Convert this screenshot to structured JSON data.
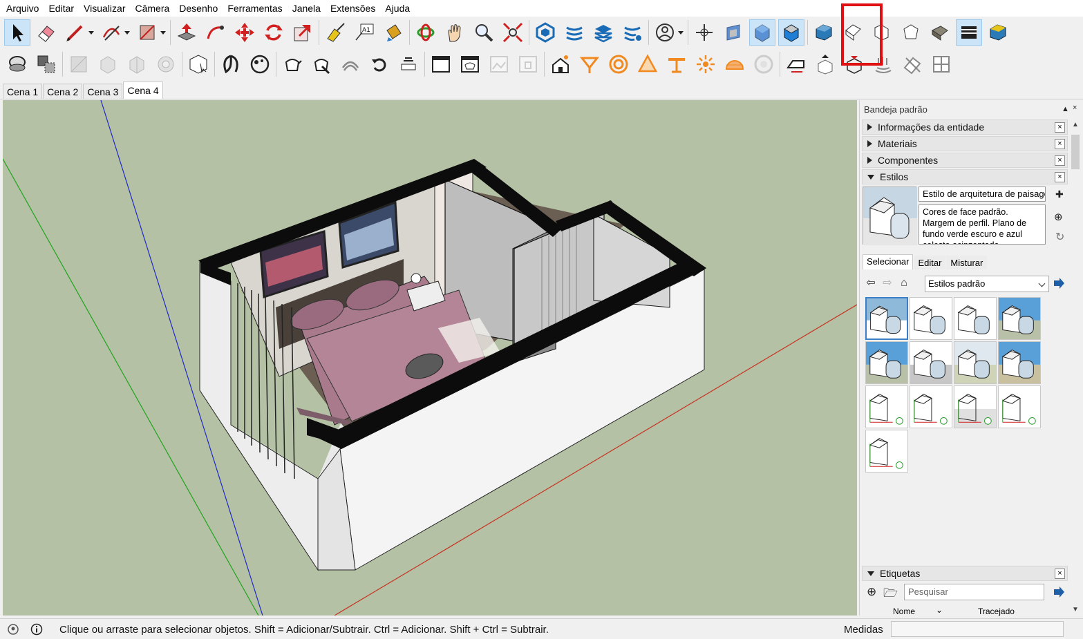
{
  "menu": [
    "Arquivo",
    "Editar",
    "Visualizar",
    "Câmera",
    "Desenho",
    "Ferramentas",
    "Janela",
    "Extensões",
    "Ajuda"
  ],
  "toolbar1": [
    {
      "name": "select-icon",
      "active": true
    },
    {
      "name": "eraser-icon"
    },
    {
      "name": "pencil-line-icon",
      "dropdown": true
    },
    {
      "name": "arc-icon",
      "dropdown": true
    },
    {
      "name": "rectangle-icon",
      "dropdown": true
    },
    {
      "name": "sep"
    },
    {
      "name": "push-pull-icon"
    },
    {
      "name": "follow-me-icon"
    },
    {
      "name": "move-icon"
    },
    {
      "name": "rotate-icon"
    },
    {
      "name": "scale-icon"
    },
    {
      "name": "sep"
    },
    {
      "name": "tape-measure-icon"
    },
    {
      "name": "text-label-icon"
    },
    {
      "name": "paint-bucket-icon"
    },
    {
      "name": "sep"
    },
    {
      "name": "orbit-icon"
    },
    {
      "name": "pan-hand-icon"
    },
    {
      "name": "zoom-icon"
    },
    {
      "name": "zoom-extents-icon"
    },
    {
      "name": "sep"
    },
    {
      "name": "warehouse-icon"
    },
    {
      "name": "extension-warehouse-icon"
    },
    {
      "name": "layout-send-icon"
    },
    {
      "name": "extension-manager-icon"
    },
    {
      "name": "sep"
    },
    {
      "name": "account-icon",
      "dropdown": true
    },
    {
      "name": "sep"
    },
    {
      "name": "axes-icon"
    },
    {
      "name": "section-plane-icon"
    },
    {
      "name": "xray-style-icon",
      "active": true
    },
    {
      "name": "shaded-style-icon",
      "active": true
    },
    {
      "name": "sep"
    },
    {
      "name": "iso-view-icon"
    },
    {
      "name": "top-view-icon"
    },
    {
      "name": "front-view-icon"
    },
    {
      "name": "right-view-icon"
    },
    {
      "name": "back-view-icon"
    },
    {
      "name": "left-view-icon",
      "active": true
    },
    {
      "name": "monochrome-icon"
    }
  ],
  "toolbar2": [
    {
      "name": "outer-shell-icon"
    },
    {
      "name": "intersect-icon"
    },
    {
      "name": "sep"
    },
    {
      "name": "union-dim-icon",
      "dim": true
    },
    {
      "name": "subtract-dim-icon",
      "dim": true
    },
    {
      "name": "trim-dim-icon",
      "dim": true
    },
    {
      "name": "split-dim-icon",
      "dim": true
    },
    {
      "name": "sep"
    },
    {
      "name": "solid-inspector-icon"
    },
    {
      "name": "sep"
    },
    {
      "name": "sandbox-contours-icon"
    },
    {
      "name": "sandbox-scratch-icon"
    },
    {
      "name": "sep"
    },
    {
      "name": "teapot-smoove-icon"
    },
    {
      "name": "teapot-stamp-icon"
    },
    {
      "name": "teapot-drape-icon"
    },
    {
      "name": "flip-edges-icon"
    },
    {
      "name": "add-detail-dim-icon"
    },
    {
      "name": "sep"
    },
    {
      "name": "window-1-icon"
    },
    {
      "name": "window-2-icon"
    },
    {
      "name": "window-3-dim-icon",
      "dim": true
    },
    {
      "name": "window-4-dim-icon",
      "dim": true
    },
    {
      "name": "sep"
    },
    {
      "name": "house-sun-icon"
    },
    {
      "name": "shadow-icon"
    },
    {
      "name": "circle-orange-icon"
    },
    {
      "name": "cone-orange-icon"
    },
    {
      "name": "table-orange-icon"
    },
    {
      "name": "sun-orange-icon"
    },
    {
      "name": "dome-orange-icon"
    },
    {
      "name": "disc-gray-icon",
      "dim": true
    },
    {
      "name": "sep"
    },
    {
      "name": "iron-icon"
    },
    {
      "name": "box-up-icon"
    },
    {
      "name": "box-down-icon"
    },
    {
      "name": "spring-icon"
    },
    {
      "name": "tag-erase-icon"
    },
    {
      "name": "grid-icon"
    }
  ],
  "scenes": [
    "Cena 1",
    "Cena 2",
    "Cena 3",
    "Cena 4"
  ],
  "active_scene": "Cena 4",
  "tray": {
    "title": "Bandeja padrão",
    "panels": {
      "entity_info": "Informações da entidade",
      "materials": "Materiais",
      "components": "Componentes",
      "styles": "Estilos",
      "tags": "Etiquetas"
    },
    "close_symbol": "×"
  },
  "styles": {
    "name": "Estilo de arquitetura de paisagem",
    "description": "Cores de face padrão. Margem de perfil. Plano de fundo verde escuro e azul celeste acinzentado.",
    "tabs": [
      "Selecionar",
      "Editar",
      "Misturar"
    ],
    "collection": "Estilos padrão"
  },
  "style_grid": [
    {
      "bg": "#ffffff",
      "sky": "#8fb9d8",
      "ground": "#ffffff",
      "sel": true
    },
    {
      "bg": "#ffffff",
      "sky": "#ffffff",
      "ground": "#ffffff"
    },
    {
      "bg": "#ffffff",
      "sky": "#ffffff",
      "ground": "#ffffff"
    },
    {
      "bg": "#ffffff",
      "sky": "#5aa0d8",
      "ground": "#b8c0a8"
    },
    {
      "bg": "#ffffff",
      "sky": "#5aa0d8",
      "ground": "#b8c0a8"
    },
    {
      "bg": "#ffffff",
      "sky": "#ffffff",
      "ground": "#c7c7c7"
    },
    {
      "bg": "#ffffff",
      "sky": "#dfe8ee",
      "ground": "#cfd3b8"
    },
    {
      "bg": "#ffffff",
      "sky": "#5aa0d8",
      "ground": "#c9c0a0"
    },
    {
      "bg": "#ffffff",
      "sky": "#ffffff",
      "ground": "#ffffff",
      "wire": true
    },
    {
      "bg": "#ffffff",
      "sky": "#ffffff",
      "ground": "#ffffff",
      "wire": true
    },
    {
      "bg": "#ffffff",
      "sky": "#ffffff",
      "ground": "#e0e0e0",
      "wire": true
    },
    {
      "bg": "#ffffff",
      "sky": "#ffffff",
      "ground": "#ffffff",
      "wire": true
    },
    {
      "bg": "#ffffff",
      "sky": "#ffffff",
      "ground": "#ffffff",
      "wire": true
    }
  ],
  "tags": {
    "search_placeholder": "Pesquisar",
    "col_name": "Nome",
    "col_dashes": "Tracejado"
  },
  "status": {
    "text": "Clique ou arraste para selecionar objetos. Shift = Adicionar/Subtrair. Ctrl = Adicionar. Shift + Ctrl = Subtrair.",
    "measure_label": "Medidas",
    "measure_value": ""
  },
  "colors": {
    "viewport_bg": "#b4c1a4",
    "highlight": "#e01010",
    "axis_red": "#c83020",
    "axis_green": "#1ea51e",
    "axis_blue": "#1e2ac8",
    "bedding": "#a87a8c"
  }
}
